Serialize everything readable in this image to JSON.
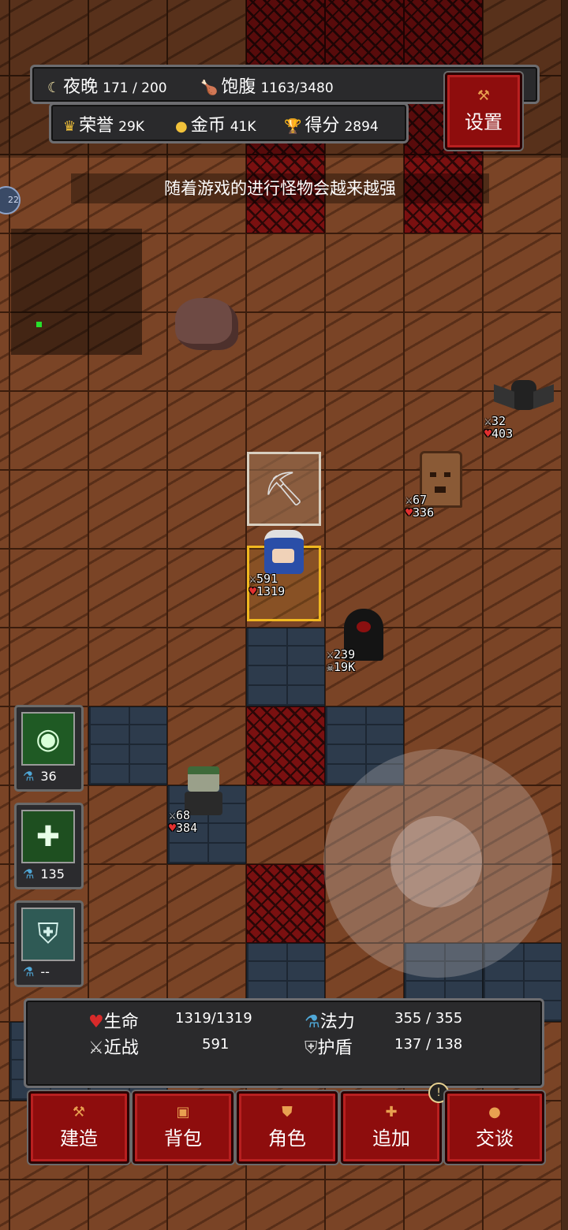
{
  "hud": {
    "night_label": "夜晚",
    "night_value": "171 / 200",
    "satiety_label": "饱腹",
    "satiety_value": "1163/3480",
    "honor_label": "荣誉",
    "honor_value": "29K",
    "gold_label": "金币",
    "gold_value": "41K",
    "score_label": "得分",
    "score_value": "2894",
    "settings_label": "设置",
    "edge_badge": "22"
  },
  "tip_text": "随着游戏的进行怪物会越来越强",
  "icons": {
    "moon": "moon-icon",
    "drumstick": "drumstick-icon",
    "crown": "crown-icon",
    "coin": "coin-icon",
    "trophy": "trophy-icon",
    "pickaxe": "pickaxe-icon",
    "sword": "sword-icon",
    "heart": "heart-icon",
    "skull": "skull-icon",
    "mana": "mana-potion-icon",
    "shield": "shield-icon"
  },
  "entities": {
    "player": {
      "attack": "591",
      "hp": "1319"
    },
    "bat": {
      "attack": "32",
      "hp": "403"
    },
    "treant": {
      "attack": "67",
      "hp": "336"
    },
    "reaper": {
      "attack": "239",
      "hp": "19K"
    },
    "zombie": {
      "attack": "68",
      "hp": "384"
    }
  },
  "skills": [
    {
      "name": "eye",
      "cost": "36"
    },
    {
      "name": "cross",
      "cost": "135"
    },
    {
      "name": "shield",
      "cost": "--"
    }
  ],
  "stats": {
    "hp_label": "生命",
    "hp_value": "1319/1319",
    "mp_label": "法力",
    "mp_value": "355 / 355",
    "melee_label": "近战",
    "melee_value": "591",
    "shield_label": "护盾",
    "shield_value": "137 / 138"
  },
  "menu": {
    "build": "建造",
    "bag": "背包",
    "character": "角色",
    "add": "追加",
    "talk": "交谈",
    "alert": "!"
  },
  "colors": {
    "button_red": "#8e0d0d",
    "accent_gold": "#f2c23a",
    "hp_red": "#e23030",
    "mana_blue": "#4fa8d8"
  }
}
